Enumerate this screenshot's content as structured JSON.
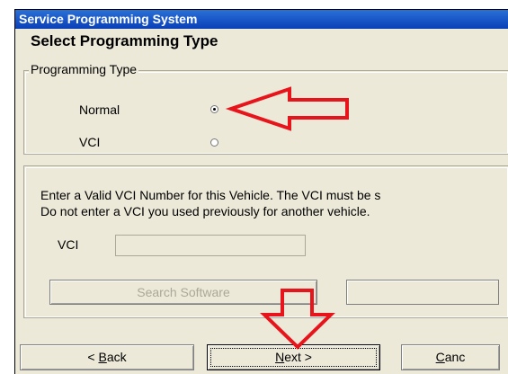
{
  "window": {
    "title": "Service Programming System"
  },
  "page": {
    "heading": "Select Programming Type"
  },
  "programming_type": {
    "legend": "Programming Type",
    "options": [
      {
        "label": "Normal",
        "selected": true
      },
      {
        "label": "VCI",
        "selected": false
      }
    ]
  },
  "vci_section": {
    "instruction_line1": "Enter a Valid VCI Number for this Vehicle. The VCI must be s",
    "instruction_line2": "Do not enter a VCI you used previously for another vehicle.",
    "vci_label": "VCI",
    "vci_value": "",
    "search_button": "Search Software"
  },
  "buttons": {
    "back_mnemonic": "B",
    "back_rest": "ack",
    "back_prefix": "< ",
    "next_mnemonic": "N",
    "next_rest": "ext >",
    "cancel_mnemonic": "C",
    "cancel_rest": "anc"
  },
  "annotations": {
    "arrow_color": "#e8141b"
  }
}
